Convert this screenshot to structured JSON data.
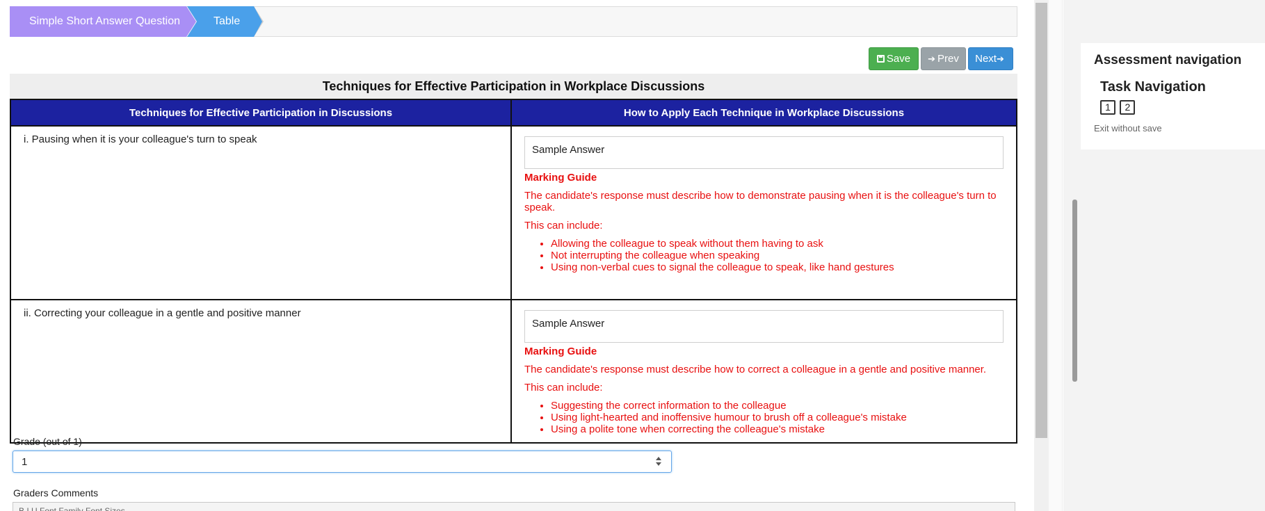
{
  "breadcrumb": {
    "items": [
      "Simple Short Answer Question",
      "Table"
    ]
  },
  "toolbar": {
    "save_label": "Save",
    "prev_label": "Prev",
    "next_label": "Next"
  },
  "table": {
    "title": "Techniques for Effective Participation in Workplace Discussions",
    "headers": [
      "Techniques for Effective Participation in Discussions",
      "How to Apply Each Technique in Workplace Discussions"
    ],
    "rows": [
      {
        "technique": "i. Pausing when it is your colleague's turn to speak",
        "answer": "Sample Answer",
        "guide_title": "Marking Guide",
        "guide_text": "The candidate's response must describe how to demonstrate pausing when it is the colleague's turn to speak.",
        "guide_include": "This can include:",
        "guide_points": [
          "Allowing the colleague to speak without them having to ask",
          "Not interrupting the colleague when speaking",
          "Using non-verbal cues to signal the colleague to speak, like hand gestures"
        ]
      },
      {
        "technique": "ii. Correcting your colleague in a gentle and positive manner",
        "answer": "Sample Answer",
        "guide_title": "Marking Guide",
        "guide_text": "The candidate's response must describe how to correct a colleague in a gentle and positive manner.",
        "guide_include": "This can include:",
        "guide_points": [
          "Suggesting the correct information to the colleague",
          "Using light-hearted and inoffensive humour to brush off a colleague's mistake",
          "Using a polite tone when correcting the colleague's mistake"
        ]
      }
    ]
  },
  "grade": {
    "label": "Grade (out of 1)",
    "value": "1"
  },
  "comments": {
    "label": "Graders Comments",
    "toolbar_text": "B  I  U   Font Family   Font Sizes"
  },
  "navigation": {
    "title": "Assessment navigation",
    "task_title": "Task Navigation",
    "tasks": [
      "1",
      "2"
    ],
    "exit_label": "Exit without save"
  },
  "colors": {
    "header_bg": "#1c22a0",
    "guide": "#e81010",
    "save": "#4caf50",
    "next": "#3a8fd6",
    "prev": "#9aa3a8"
  }
}
